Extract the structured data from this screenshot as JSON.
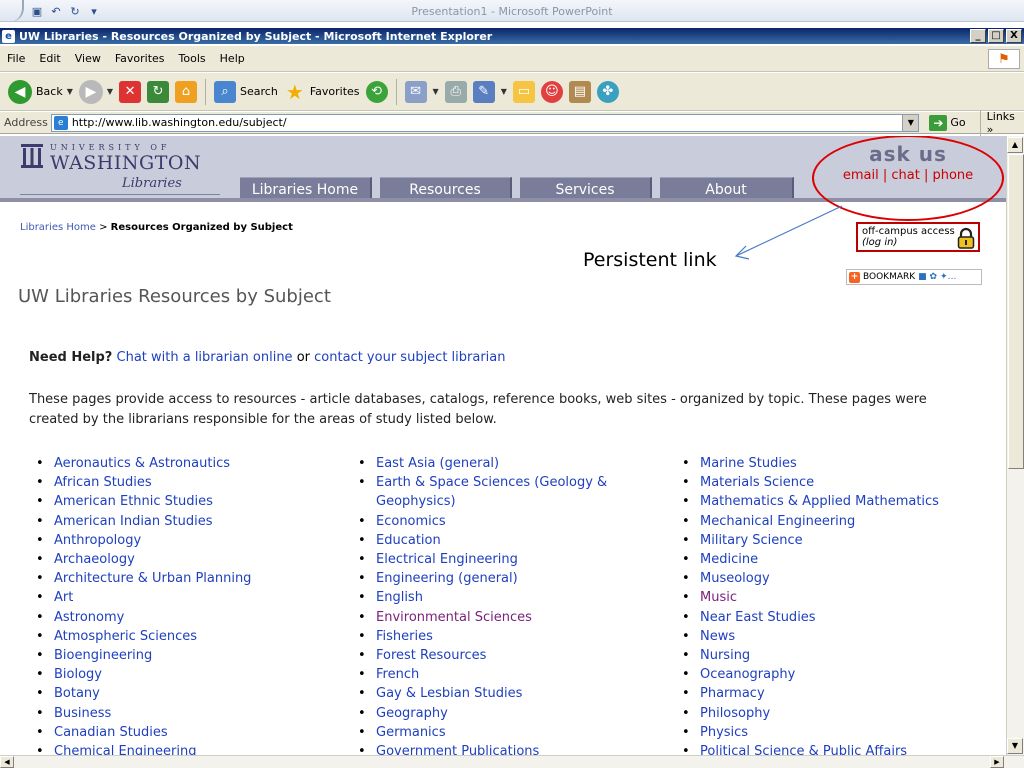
{
  "ppt": {
    "title": "Presentation1 - Microsoft PowerPoint"
  },
  "window": {
    "title": "UW Libraries - Resources Organized by Subject - Microsoft Internet Explorer",
    "min": "_",
    "max": "□",
    "close": "X"
  },
  "menu": [
    "File",
    "Edit",
    "View",
    "Favorites",
    "Tools",
    "Help"
  ],
  "toolbar": {
    "back": "Back",
    "search": "Search",
    "favorites": "Favorites"
  },
  "address": {
    "label": "Address",
    "url": "http://www.lib.washington.edu/subject/",
    "go": "Go",
    "links": "Links"
  },
  "site": {
    "univ": "UNIVERSITY OF",
    "washington": "WASHINGTON",
    "libraries": "Libraries",
    "nav": [
      "Libraries Home",
      "Resources",
      "Services",
      "About"
    ],
    "ask": {
      "title": "ask us",
      "email": "email",
      "chat": "chat",
      "phone": "phone",
      "sep": "|"
    }
  },
  "breadcrumb": {
    "home": "Libraries Home",
    "sep": ">",
    "current": "Resources Organized by Subject"
  },
  "offcampus": {
    "line1": "off-campus access",
    "line2": "(log in)"
  },
  "annotation": "Persistent link",
  "bookmark": "BOOKMARK",
  "page": {
    "title": "UW Libraries Resources by Subject",
    "help_label": "Need Help?",
    "help_link1": "Chat with a librarian online",
    "help_or": "or",
    "help_link2": "contact your subject librarian",
    "desc": "These pages provide access to resources - article databases, catalogs, reference books, web sites - organized by topic. These pages were created by the librarians responsible for the areas of study listed below."
  },
  "subjects": {
    "col1": [
      "Aeronautics & Astronautics",
      "African Studies",
      "American Ethnic Studies",
      "American Indian Studies",
      "Anthropology",
      "Archaeology",
      "Architecture & Urban Planning",
      "Art",
      "Astronomy",
      "Atmospheric Sciences",
      "Bioengineering",
      "Biology",
      "Botany",
      "Business",
      "Canadian Studies",
      "Chemical Engineering"
    ],
    "col2": [
      "East Asia (general)",
      "Earth & Space Sciences (Geology &",
      "Geophysics)",
      "Economics",
      "Education",
      "Electrical Engineering",
      "Engineering (general)",
      "English",
      "Environmental Sciences",
      "Fisheries",
      "Forest Resources",
      "French",
      "Gay & Lesbian Studies",
      "Geography",
      "Germanics",
      "Government Publications"
    ],
    "col3": [
      "Marine Studies",
      "Materials Science",
      "Mathematics & Applied Mathematics",
      "Mechanical Engineering",
      "Military Science",
      "Medicine",
      "Museology",
      "Music",
      "Near East Studies",
      "News",
      "Nursing",
      "Oceanography",
      "Pharmacy",
      "Philosophy",
      "Physics",
      "Political Science & Public Affairs"
    ]
  },
  "colors": {
    "link": "#1e3fbf",
    "visited": "#7a1f7a",
    "header": "#c9ccda",
    "tab": "#7a7d99",
    "highlight": "#dd0000"
  }
}
